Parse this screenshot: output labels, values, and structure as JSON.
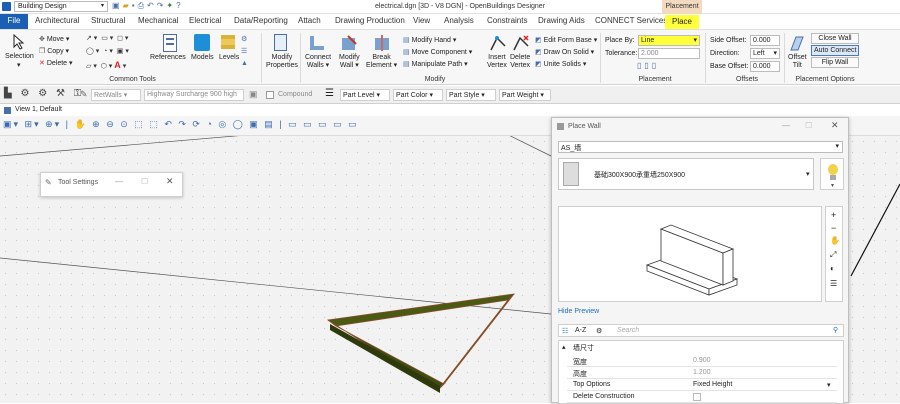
{
  "app": {
    "workflow_select": "Building Design",
    "title": "electrical.dgn [3D - V8 DGN] - OpenBuildings Designer",
    "context_tab_header": "Placement"
  },
  "tabs": [
    "File",
    "Architectural",
    "Structural",
    "Mechanical",
    "Electrical",
    "Data/Reporting",
    "Attach",
    "Drawing Production",
    "View",
    "Analysis",
    "Constraints",
    "Drawing Aids",
    "CONNECT Services",
    "Place"
  ],
  "ribbon": {
    "selection": "Selection",
    "move": "Move",
    "copy": "Copy",
    "delete": "Delete",
    "references": "References",
    "models": "Models",
    "levels": "Levels",
    "common_tools": "Common Tools",
    "modify_properties": "Modify Properties",
    "connect_walls": "Connect Walls",
    "modify_wall": "Modify Wall",
    "break_element": "Break Element",
    "modify_hand": "Modify Hand",
    "move_component": "Move Component",
    "manipulate_path": "Manipulate Path",
    "insert_vertex": "Insert Vertex",
    "delete_vertex": "Delete Vertex",
    "edit_form_base": "Edit Form Base",
    "draw_on_solid": "Draw On Solid",
    "unite_solids": "Unite Solids",
    "modify": "Modify",
    "place_by_label": "Place By:",
    "place_by_value": "Line",
    "tolerance_label": "Tolerance:",
    "tolerance_value": "2.000",
    "placement": "Placement",
    "side_offset_label": "Side Offset:",
    "side_offset_value": "0.000",
    "direction_label": "Direction:",
    "direction_value": "Left",
    "base_offset_label": "Base Offset:",
    "base_offset_value": "0.000",
    "offsets": "Offsets",
    "offset_tilt": "Offset Tilt",
    "close_wall": "Close Wall",
    "auto_connect": "Auto Connect",
    "flip_wall": "Flip Wall",
    "placement_options": "Placement Options"
  },
  "attrbar": {
    "level": "RetWalls",
    "template": "Highway Surcharge 900 high",
    "compound": "Compound",
    "part_level": "Part Level",
    "part_color": "Part Color",
    "part_style": "Part Style",
    "part_weight": "Part Weight"
  },
  "view": {
    "title": "View 1, Default"
  },
  "tool_settings": {
    "title": "Tool Settings"
  },
  "place_wall": {
    "title": "Place Wall",
    "catalog": "AS_墙",
    "item": "基础300X900承重墙250X900",
    "hide_preview": "Hide Preview",
    "az": "A-Z",
    "search_placeholder": "Search",
    "section": "墙尺寸",
    "rows": [
      {
        "label": "宽度",
        "value": "0.900"
      },
      {
        "label": "高度",
        "value": "1.200"
      },
      {
        "label": "Top Options",
        "value": "Fixed Height"
      },
      {
        "label": "Delete Construction",
        "value": ""
      }
    ]
  },
  "colors": {
    "ribbon_bg": "#f7f7f7",
    "active_tab": "#ffff3a",
    "file_tab": "#1a5fb4",
    "wall_fill": "#4a5a12",
    "canvas_bg": "#f2f2f2"
  }
}
